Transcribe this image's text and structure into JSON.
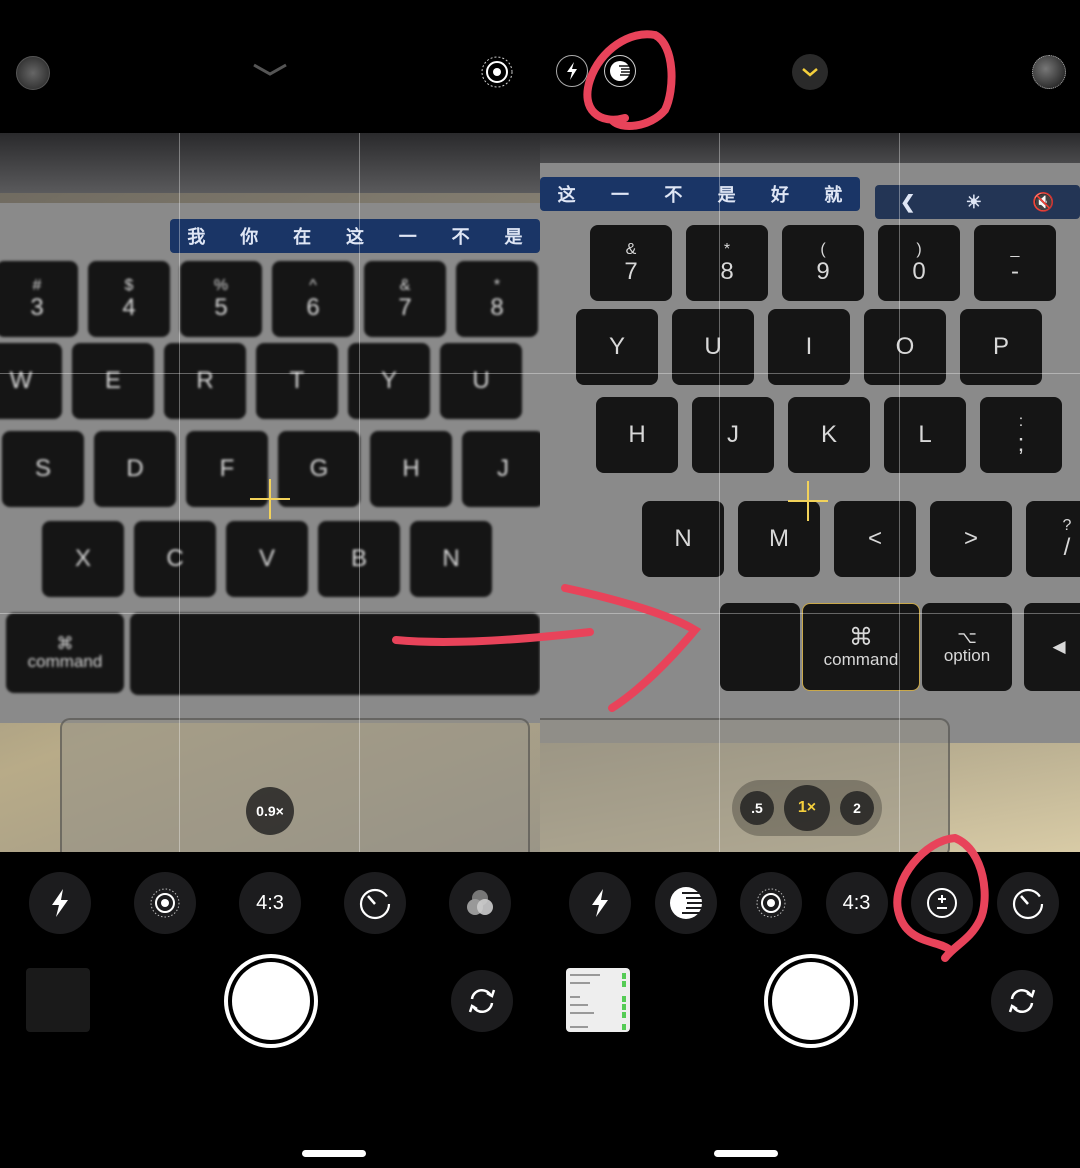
{
  "left": {
    "touchbar": [
      "我",
      "你",
      "在",
      "这",
      "一",
      "不",
      "是"
    ],
    "rows": [
      {
        "keys": [
          [
            "#",
            "3"
          ],
          [
            "$",
            "4"
          ],
          [
            "%",
            "5"
          ],
          [
            "^",
            "6"
          ],
          [
            "&",
            "7"
          ],
          [
            "*",
            "8"
          ]
        ]
      },
      {
        "keys": [
          [
            "",
            "W"
          ],
          [
            "",
            "E"
          ],
          [
            "",
            "R"
          ],
          [
            "",
            "T"
          ],
          [
            "",
            "Y"
          ],
          [
            "",
            "U"
          ]
        ]
      },
      {
        "keys": [
          [
            "",
            "S"
          ],
          [
            "",
            "D"
          ],
          [
            "",
            "F"
          ],
          [
            "",
            "G"
          ],
          [
            "",
            "H"
          ],
          [
            "",
            "J"
          ]
        ]
      },
      {
        "keys": [
          [
            "",
            "X"
          ],
          [
            "",
            "C"
          ],
          [
            "",
            "V"
          ],
          [
            "",
            "B"
          ],
          [
            "",
            "N"
          ]
        ]
      }
    ],
    "command_key": {
      "symbol": "⌘",
      "label": "command"
    },
    "zoom_label": "0.9×",
    "controls": [
      {
        "name": "flash",
        "icon": "flash-icon"
      },
      {
        "name": "live-photo",
        "icon": "live-photo-icon"
      },
      {
        "name": "aspect-ratio",
        "label": "4:3"
      },
      {
        "name": "timer",
        "icon": "timer-icon"
      },
      {
        "name": "filters",
        "icon": "filters-icon"
      }
    ]
  },
  "right": {
    "touchbar": [
      "这",
      "一",
      "不",
      "是",
      "好",
      "就"
    ],
    "touchbar_controls": [
      "❮",
      "☀",
      "🔇"
    ],
    "rows": [
      {
        "keys": [
          [
            "&",
            "7"
          ],
          [
            "*",
            "8"
          ],
          [
            "(",
            "9"
          ],
          [
            ")",
            "0"
          ],
          [
            "_",
            "-"
          ]
        ]
      },
      {
        "keys": [
          [
            "",
            "Y"
          ],
          [
            "",
            "U"
          ],
          [
            "",
            "I"
          ],
          [
            "",
            "O"
          ],
          [
            "",
            "P"
          ]
        ]
      },
      {
        "keys": [
          [
            "",
            "H"
          ],
          [
            "",
            "J"
          ],
          [
            "",
            "K"
          ],
          [
            "",
            "L"
          ],
          [
            ":",
            ";"
          ]
        ]
      },
      {
        "keys": [
          [
            "",
            "N"
          ],
          [
            "",
            "M"
          ],
          [
            "",
            "<"
          ],
          [
            "",
            ">"
          ],
          [
            "?",
            "/"
          ]
        ]
      }
    ],
    "command_key": {
      "symbol": "⌘",
      "label": "command"
    },
    "option_key": {
      "symbol": "⌥",
      "label": "option"
    },
    "zoom_options": [
      ".5",
      "1×",
      "2"
    ],
    "controls": [
      {
        "name": "flash",
        "icon": "flash-icon"
      },
      {
        "name": "night-mode",
        "icon": "night-mode-icon"
      },
      {
        "name": "live-photo",
        "icon": "live-photo-icon"
      },
      {
        "name": "aspect-ratio",
        "label": "4:3"
      },
      {
        "name": "exposure",
        "icon": "exposure-icon"
      },
      {
        "name": "timer",
        "icon": "timer-icon"
      }
    ]
  },
  "colors": {
    "annotation": "#e8435a",
    "accent": "#f4cf3c"
  }
}
